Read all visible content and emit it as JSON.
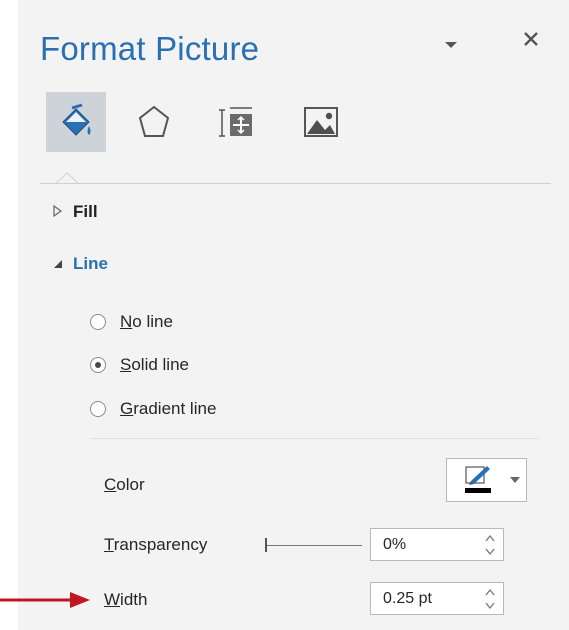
{
  "pane": {
    "title": "Format Picture",
    "tabs": [
      {
        "icon": "fill-line-icon",
        "active": true
      },
      {
        "icon": "effects-icon",
        "active": false
      },
      {
        "icon": "size-properties-icon",
        "active": false
      },
      {
        "icon": "picture-icon",
        "active": false
      }
    ]
  },
  "sections": {
    "fill": {
      "label": "Fill",
      "expanded": false
    },
    "line": {
      "label": "Line",
      "expanded": true
    }
  },
  "line": {
    "options": [
      {
        "hotkey": "N",
        "rest": "o line",
        "checked": false
      },
      {
        "hotkey": "S",
        "rest": "olid line",
        "checked": true
      },
      {
        "hotkey": "G",
        "rest": "radient line",
        "checked": false
      }
    ],
    "color": {
      "hotkey": "C",
      "rest": "olor",
      "swatch": "#000000"
    },
    "transparency": {
      "hotkey": "T",
      "rest": "ransparency",
      "value": "0%",
      "slider_fraction": 0
    },
    "width": {
      "hotkey": "W",
      "rest": "idth",
      "value": "0.25 pt"
    }
  },
  "colors": {
    "accent": "#2b6fb3",
    "annotation_arrow": "#c0161f"
  }
}
